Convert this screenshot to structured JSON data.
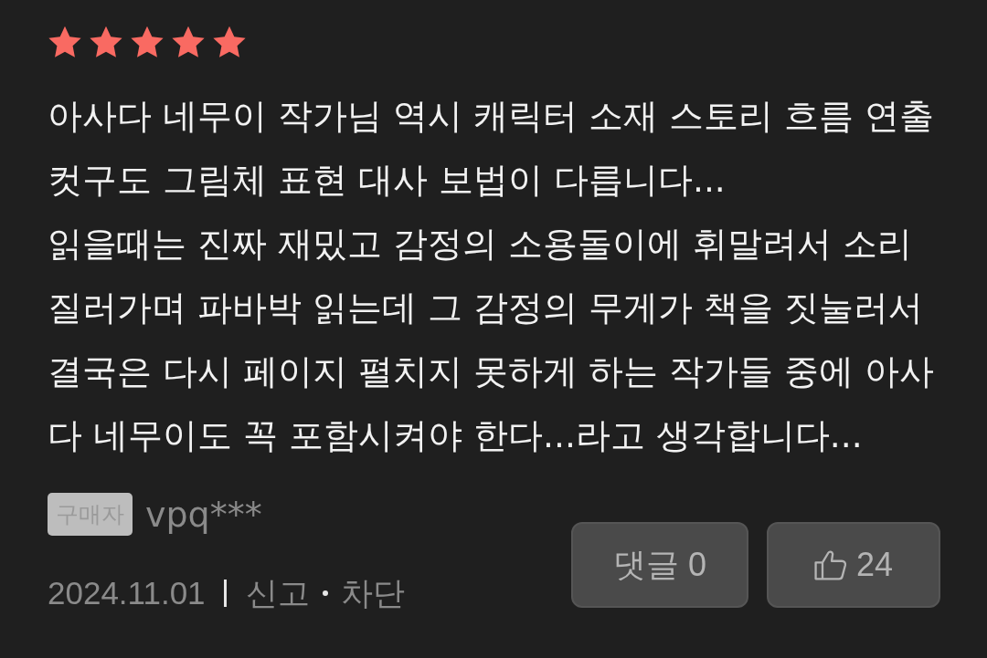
{
  "rating": {
    "stars": 5
  },
  "review": {
    "paragraphs": [
      "아사다 네무이 작가님 역시 캐릭터 소재 스토리 흐름 연출 컷구도 그림체 표현 대사 보법이 다릅니다...",
      "읽을때는 진짜 재밌고 감정의 소용돌이에 휘말려서 소리 질러가며 파바박 읽는데 그 감정의 무게가 책을 짓눌러서 결국은 다시 페이지 펼치지 못하게 하는 작가들 중에 아사다 네무이도 꼭 포함시켜야 한다...라고 생각합니다..."
    ]
  },
  "author": {
    "badge": "구매자",
    "name": "vpq***"
  },
  "meta": {
    "date": "2024.11.01",
    "actions": [
      {
        "label": "신고"
      },
      {
        "label": "차단"
      }
    ]
  },
  "buttons": [
    {
      "kind": "comments",
      "label": "댓글 0"
    },
    {
      "kind": "like",
      "label": "24"
    }
  ]
}
